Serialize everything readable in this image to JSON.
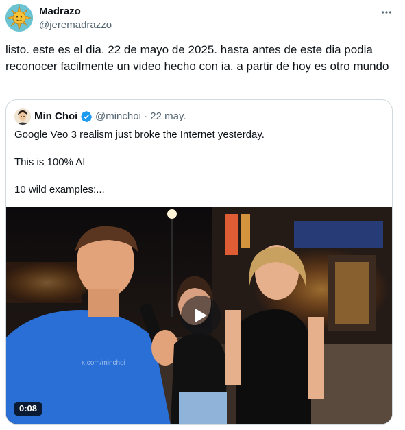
{
  "tweet": {
    "author_name": "Madrazo",
    "author_handle": "@jeremadrazzo",
    "more_icon": "more-horizontal-icon",
    "text": "listo. este es el dia. 22 de mayo de 2025. hasta antes de este dia podia reconocer facilmente un video hecho con ia. a partir de hoy es otro mundo"
  },
  "quote": {
    "author_name": "Min Choi",
    "verified_icon": "verified-badge-icon",
    "verified_color": "#1d9bf0",
    "author_handle": "@minchoi",
    "separator": "·",
    "date": "22 may.",
    "lines": [
      "Google Veo 3 realism just broke the Internet yesterday.",
      "This is 100% AI",
      "10 wild examples:..."
    ],
    "media": {
      "type": "video",
      "play_icon": "play-icon",
      "duration": "0:08",
      "watermark": "x.com/minchoi"
    }
  },
  "colors": {
    "text_primary": "#0f1419",
    "text_secondary": "#536471",
    "border": "#cfd9de"
  }
}
